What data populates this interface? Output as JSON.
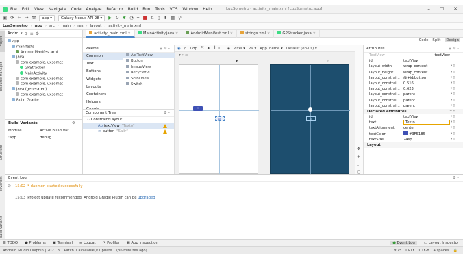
{
  "menubar": {
    "items": [
      "File",
      "Edit",
      "View",
      "Navigate",
      "Code",
      "Analyze",
      "Refactor",
      "Build",
      "Run",
      "Tools",
      "VCS",
      "Window",
      "Help"
    ],
    "window_title": "LuxSometro - activity_main.xml [LuxSometro.app]",
    "window_buttons": [
      "–",
      "☐",
      "✕"
    ]
  },
  "toolbar": {
    "config": "app ▾",
    "device": "Galaxy Nexus API 28 ▾"
  },
  "breadcrumb": [
    "LuxSometro",
    "app",
    "src",
    "main",
    "res",
    "layout",
    "activity_main.xml"
  ],
  "left_tabs": [
    "Project",
    "Resource Manager",
    "Structure",
    "Favorites",
    "Build Variants"
  ],
  "project": {
    "view": "Andro",
    "tree": [
      {
        "label": "app",
        "icon": "folder",
        "indent": 0
      },
      {
        "label": "manifests",
        "icon": "folder",
        "indent": 1
      },
      {
        "label": "AndroidManifest.xml",
        "icon": "manifest",
        "indent": 2
      },
      {
        "label": "java",
        "icon": "folder",
        "indent": 1
      },
      {
        "label": "com.example.luxsomet",
        "icon": "pkg",
        "indent": 2
      },
      {
        "label": "GPStracker",
        "icon": "kotlin",
        "indent": 3
      },
      {
        "label": "MainActivity",
        "icon": "kotlin",
        "indent": 3
      },
      {
        "label": "com.example.luxsomet",
        "icon": "pkg",
        "indent": 2
      },
      {
        "label": "com.example.luxsomet",
        "icon": "pkg",
        "indent": 2
      },
      {
        "label": "java (generated)",
        "icon": "folder",
        "indent": 1
      },
      {
        "label": "com.example.luxsomet",
        "icon": "pkg",
        "indent": 2
      },
      {
        "label": "Build Gradle",
        "icon": "folder",
        "indent": 1
      }
    ]
  },
  "build_variants": {
    "title": "Build Variants",
    "col_module": "Module",
    "col_variant": "Active Build Var...",
    "row_module": ":app",
    "row_variant": "debug"
  },
  "editor_tabs": [
    {
      "label": "activity_main.xml",
      "color": "#e7a43a",
      "active": true
    },
    {
      "label": "MainActivity.java",
      "color": "#3ddc84",
      "active": false
    },
    {
      "label": "AndroidManifest.xml",
      "color": "#6a9f55",
      "active": false
    },
    {
      "label": "strings.xml",
      "color": "#e7a43a",
      "active": false
    },
    {
      "label": "GPStracker.java",
      "color": "#3ddc84",
      "active": false
    }
  ],
  "modes": {
    "code": "Code",
    "split": "Split",
    "design": "Design"
  },
  "palette": {
    "title": "Palette",
    "categories": [
      "Common",
      "Text",
      "Buttons",
      "Widgets",
      "Layouts",
      "Containers",
      "Helpers",
      "Google"
    ],
    "items": [
      "Ab TextView",
      "Button",
      "ImageView",
      "RecyclerVi...",
      "ScrollView",
      "Switch"
    ]
  },
  "component_tree": {
    "title": "Component Tree",
    "root": "ConstraintLayout",
    "children": [
      {
        "label": "textView",
        "value": "\"Texto\"",
        "selected": true
      },
      {
        "label": "button",
        "value": "\"Salir\"",
        "selected": false
      }
    ]
  },
  "canvas_toolbar": {
    "device": "Pixel ▾",
    "api": "29 ▾",
    "theme": "AppTheme ▾",
    "locale": "Default (en-us) ▾"
  },
  "attributes": {
    "title": "Attributes",
    "widget_type": "TextView",
    "widget_type_value": "textView",
    "id_label": "id",
    "id_value": "textView",
    "layout_rows": [
      {
        "name": "layout_width",
        "value": "wrap_content"
      },
      {
        "name": "layout_height",
        "value": "wrap_content"
      },
      {
        "name": "layout_constrain...",
        "value": "@+id/button"
      },
      {
        "name": "layout_constrain...",
        "value": "0.516"
      },
      {
        "name": "layout_constrain...",
        "value": "0.623"
      },
      {
        "name": "layout_constrain...",
        "value": "parent"
      },
      {
        "name": "layout_constrain...",
        "value": "parent"
      },
      {
        "name": "layout_constrain...",
        "value": "parent"
      }
    ],
    "declared_section": "Declared Attributes",
    "declared_rows": [
      {
        "name": "id",
        "value": "textView"
      },
      {
        "name": "text",
        "value": "Texto"
      },
      {
        "name": "textAlignment",
        "value": "center"
      },
      {
        "name": "textColor",
        "value": "#3F51B5"
      },
      {
        "name": "textSize",
        "value": "24sp"
      }
    ],
    "layout_section": "Layout"
  },
  "event_log": {
    "title": "Event Log",
    "lines": [
      {
        "ts": "15:02",
        "text": "* daemon started successfully",
        "link": ""
      },
      {
        "ts": "15:03",
        "text": "Project update recommended: Android Gradle Plugin can be ",
        "link": "upgraded"
      }
    ]
  },
  "bottom_tabs": [
    "TODO",
    "Problems",
    "Terminal",
    "Logcat",
    "Profiler",
    "App Inspection"
  ],
  "bottom_right_tabs": [
    "Event Log",
    "Layout Inspector"
  ],
  "status": {
    "message": "Android Studio Dolphin | 2021.3.1 Patch 1 available // Update... (36 minutes ago)",
    "position": "9:75",
    "line_sep": "CRLF",
    "encoding": "UTF-8",
    "indent": "4 spaces"
  }
}
